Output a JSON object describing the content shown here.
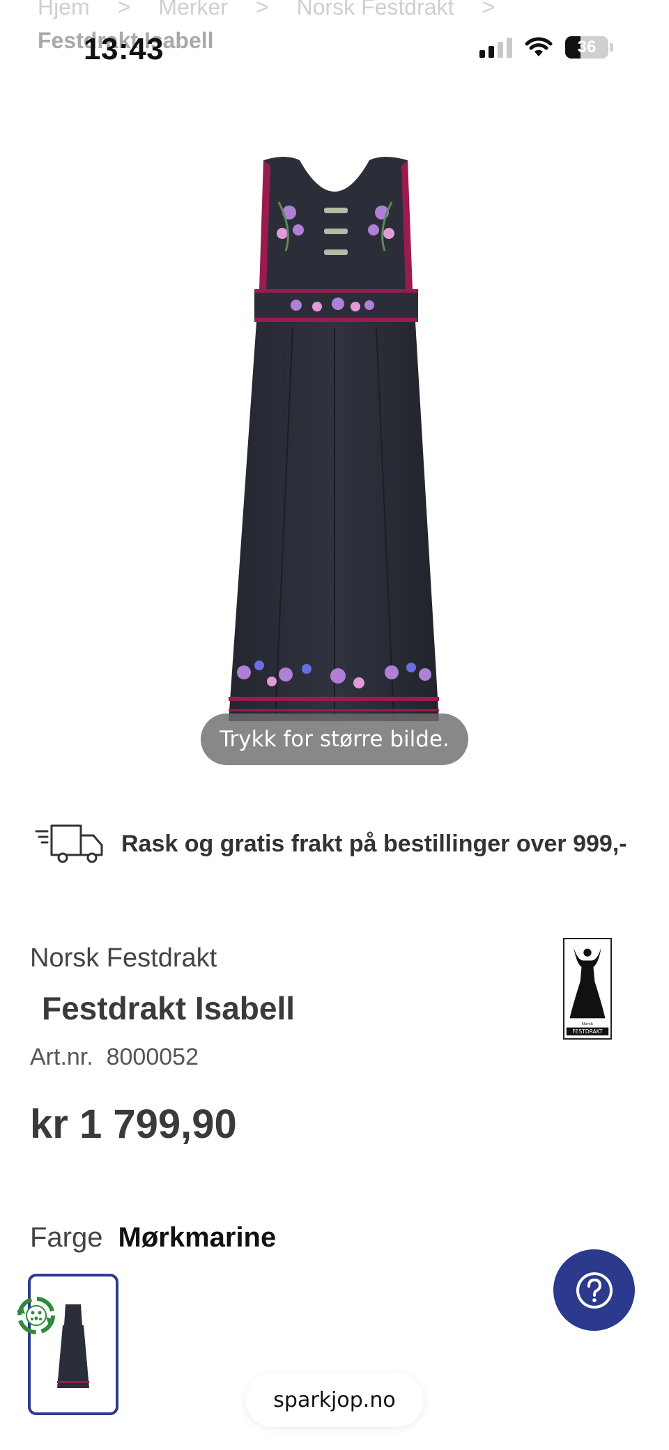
{
  "status_bar": {
    "time": "13:43",
    "battery_level": "36",
    "icons": [
      "signal-icon",
      "wifi-icon",
      "battery-icon"
    ]
  },
  "breadcrumb": {
    "items": [
      "Hjem",
      "Merker",
      "Norsk Festdrakt"
    ],
    "current": "Festdrakt Isabell",
    "separator": ">"
  },
  "image": {
    "zoom_hint": "Trykk for større bilde."
  },
  "shipping": {
    "text": "Rask og gratis frakt på bestillinger over 999,-",
    "icon": "truck-icon"
  },
  "product": {
    "brand": "Norsk Festdrakt",
    "title": "Festdrakt Isabell",
    "artnr_label": "Art.nr.",
    "artnr_value": "8000052",
    "price": "kr 1 799,90",
    "brand_logo_text": "FESTDRAKT",
    "brand_logo_small": "Norsk"
  },
  "color": {
    "label": "Farge",
    "value": "Mørkmarine"
  },
  "browser": {
    "url": "sparkjop.no"
  },
  "colors": {
    "accent_blue": "#2b3a8d",
    "dress": "#2a2d3a",
    "trim": "#9b1b4f"
  }
}
